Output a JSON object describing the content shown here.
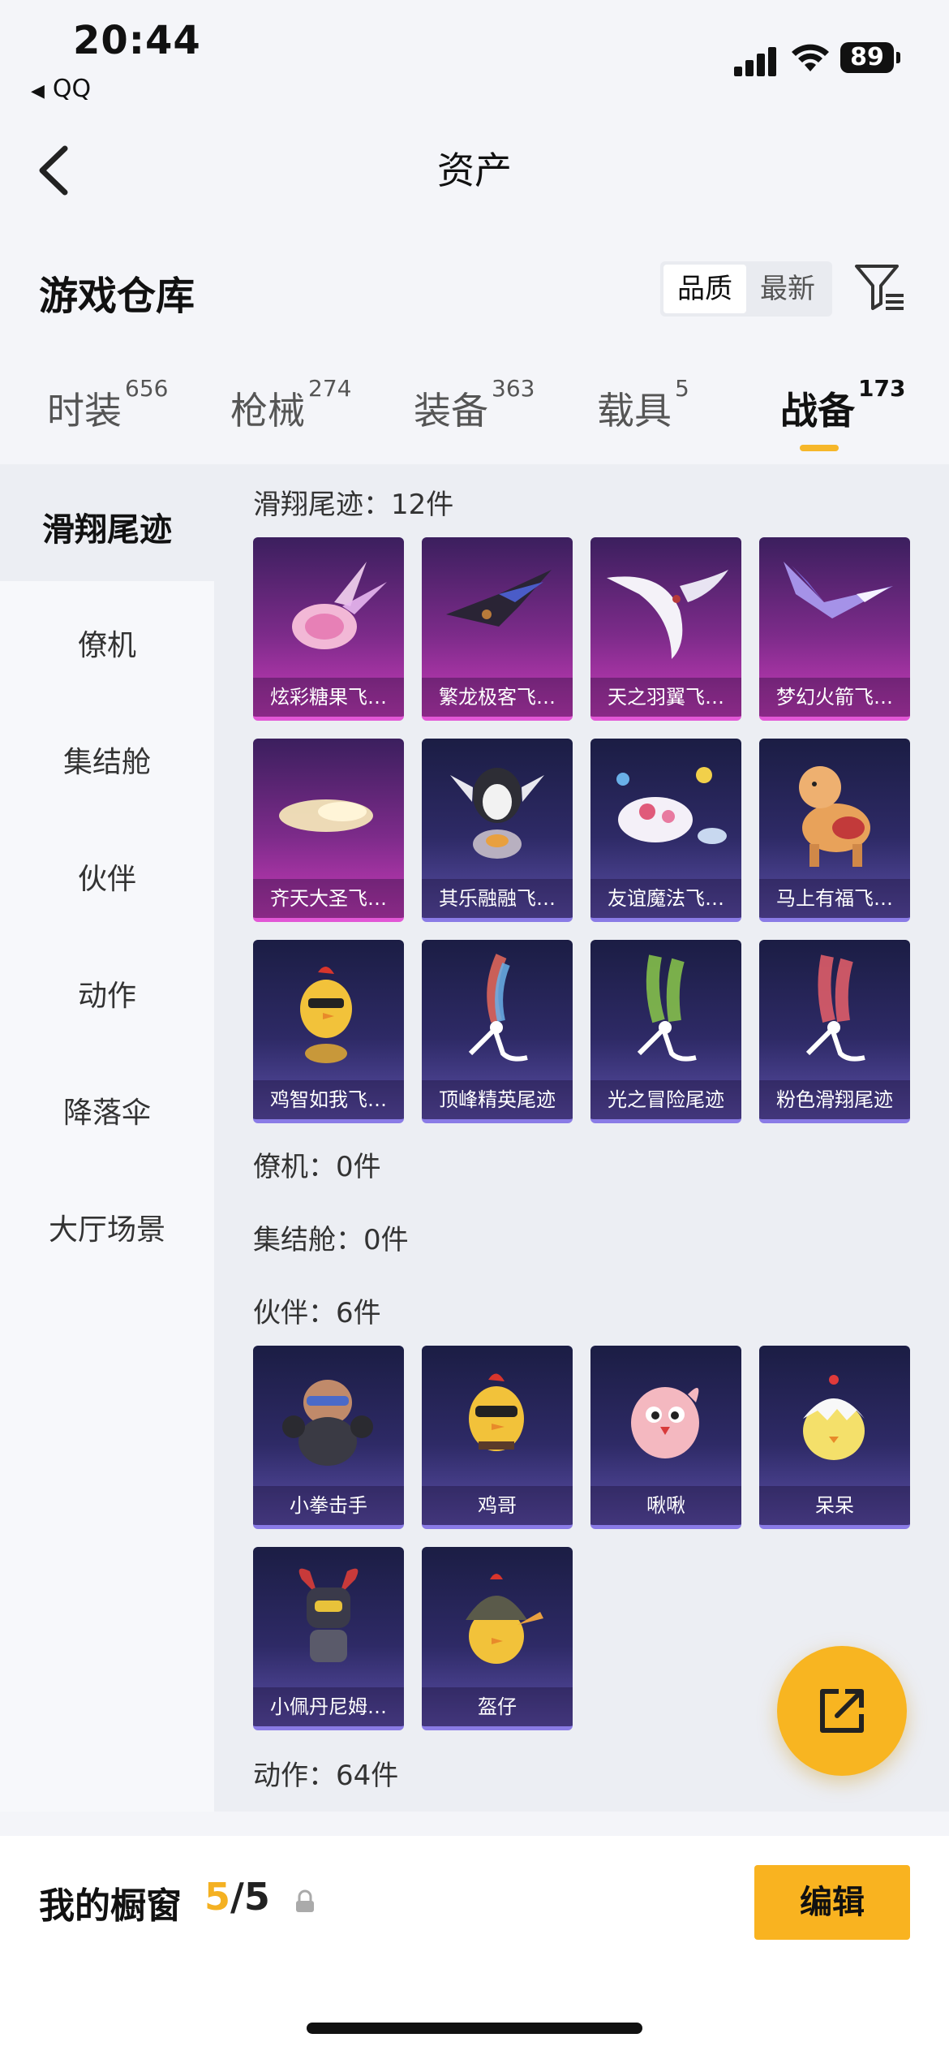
{
  "status_bar": {
    "time": "20:44",
    "back_app": "QQ",
    "battery": "89"
  },
  "nav": {
    "title": "资产"
  },
  "warehouse": {
    "title": "游戏仓库",
    "sort_options": [
      {
        "label": "品质",
        "active": true
      },
      {
        "label": "最新",
        "active": false
      }
    ]
  },
  "tabs": [
    {
      "label": "时装",
      "count": "656"
    },
    {
      "label": "枪械",
      "count": "274"
    },
    {
      "label": "装备",
      "count": "363"
    },
    {
      "label": "载具",
      "count": "5"
    },
    {
      "label": "战备",
      "count": "173",
      "active": true
    }
  ],
  "sidebar": [
    {
      "label": "滑翔尾迹",
      "active": true
    },
    {
      "label": "僚机"
    },
    {
      "label": "集结舱"
    },
    {
      "label": "伙伴"
    },
    {
      "label": "动作"
    },
    {
      "label": "降落伞"
    },
    {
      "label": "大厅场景"
    }
  ],
  "sections": {
    "glide": {
      "title": "滑翔尾迹：12件"
    },
    "wingman": {
      "title": "僚机：0件"
    },
    "capsule": {
      "title": "集结舱：0件"
    },
    "partner": {
      "title": "伙伴：6件"
    },
    "action": {
      "title": "动作：64件"
    }
  },
  "glide_items": [
    {
      "name": "炫彩糖果飞…",
      "rarity": "pink",
      "icon": "candy-wings-icon"
    },
    {
      "name": "繁龙极客飞…",
      "rarity": "pink",
      "icon": "dragon-glider-icon"
    },
    {
      "name": "天之羽翼飞…",
      "rarity": "pink",
      "icon": "white-wings-icon"
    },
    {
      "name": "梦幻火箭飞…",
      "rarity": "pink",
      "icon": "rocket-glider-icon"
    },
    {
      "name": "齐天大圣飞…",
      "rarity": "pink",
      "icon": "golden-cloud-icon"
    },
    {
      "name": "其乐融融飞…",
      "rarity": "blue",
      "icon": "penguin-icon"
    },
    {
      "name": "友谊魔法飞…",
      "rarity": "blue",
      "icon": "magic-cloud-icon"
    },
    {
      "name": "马上有福飞…",
      "rarity": "blue",
      "icon": "horse-icon"
    },
    {
      "name": "鸡智如我飞…",
      "rarity": "blue",
      "icon": "chicken-icon"
    },
    {
      "name": "顶峰精英尾迹",
      "rarity": "blue",
      "icon": "rainbow-trail-icon"
    },
    {
      "name": "光之冒险尾迹",
      "rarity": "blue",
      "icon": "green-trail-icon"
    },
    {
      "name": "粉色滑翔尾迹",
      "rarity": "blue",
      "icon": "pink-trail-icon"
    }
  ],
  "partner_items": [
    {
      "name": "小拳击手",
      "rarity": "blue",
      "icon": "boxer-icon"
    },
    {
      "name": "鸡哥",
      "rarity": "blue",
      "icon": "chicken-bro-icon"
    },
    {
      "name": "啾啾",
      "rarity": "blue",
      "icon": "pink-bird-icon"
    },
    {
      "name": "呆呆",
      "rarity": "blue",
      "icon": "egg-chick-icon"
    },
    {
      "name": "小佩丹尼姆…",
      "rarity": "blue",
      "icon": "robot-icon"
    },
    {
      "name": "盔仔",
      "rarity": "blue",
      "icon": "helmet-chick-icon"
    }
  ],
  "showcase": {
    "label": "我的橱窗",
    "used": "5",
    "total": "/5"
  },
  "edit_label": "编辑",
  "colors": {
    "accent": "#f8b521",
    "pink_rarity": "#e257d6",
    "blue_rarity": "#8a7be6"
  }
}
